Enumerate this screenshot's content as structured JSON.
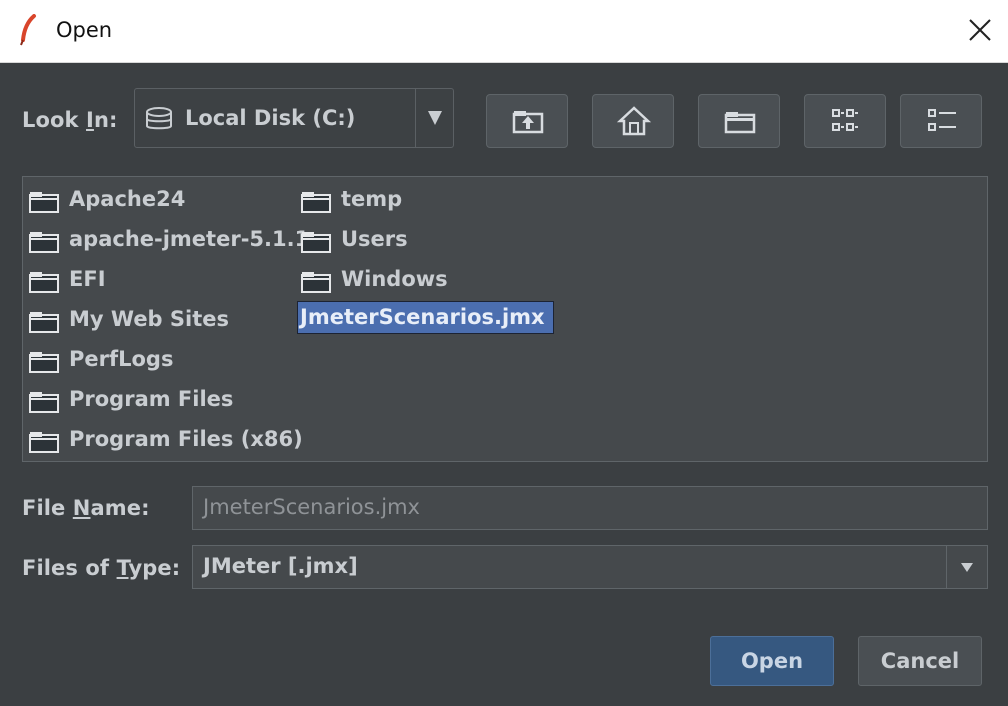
{
  "window": {
    "title": "Open"
  },
  "look_in": {
    "label_pre": "Look ",
    "label_mnemonic": "I",
    "label_post": "n:",
    "value": "Local Disk (C:)",
    "icon": "disk-icon"
  },
  "toolbar": {
    "buttons": [
      {
        "name": "up-one-level-icon"
      },
      {
        "name": "home-icon"
      },
      {
        "name": "new-folder-icon"
      },
      {
        "name": "list-view-icon"
      },
      {
        "name": "details-view-icon"
      }
    ]
  },
  "files": {
    "column1": [
      "Apache24",
      "apache-jmeter-5.1.1",
      "EFI",
      "My Web Sites",
      "PerfLogs",
      "Program Files",
      "Program Files (x86)"
    ],
    "column2": [
      "temp",
      "Users",
      "Windows"
    ],
    "selected_file": "JmeterScenarios.jmx"
  },
  "file_name": {
    "label_pre": "File ",
    "label_mnemonic": "N",
    "label_post": "ame:",
    "value": "JmeterScenarios.jmx"
  },
  "files_of_type": {
    "label_pre": "Files of ",
    "label_mnemonic": "T",
    "label_post": "ype:",
    "value": "JMeter [.jmx]"
  },
  "buttons": {
    "open": "Open",
    "cancel": "Cancel"
  },
  "colors": {
    "background": "#3b3f42",
    "selection": "#4b6eaf",
    "primary_button": "#365880"
  }
}
